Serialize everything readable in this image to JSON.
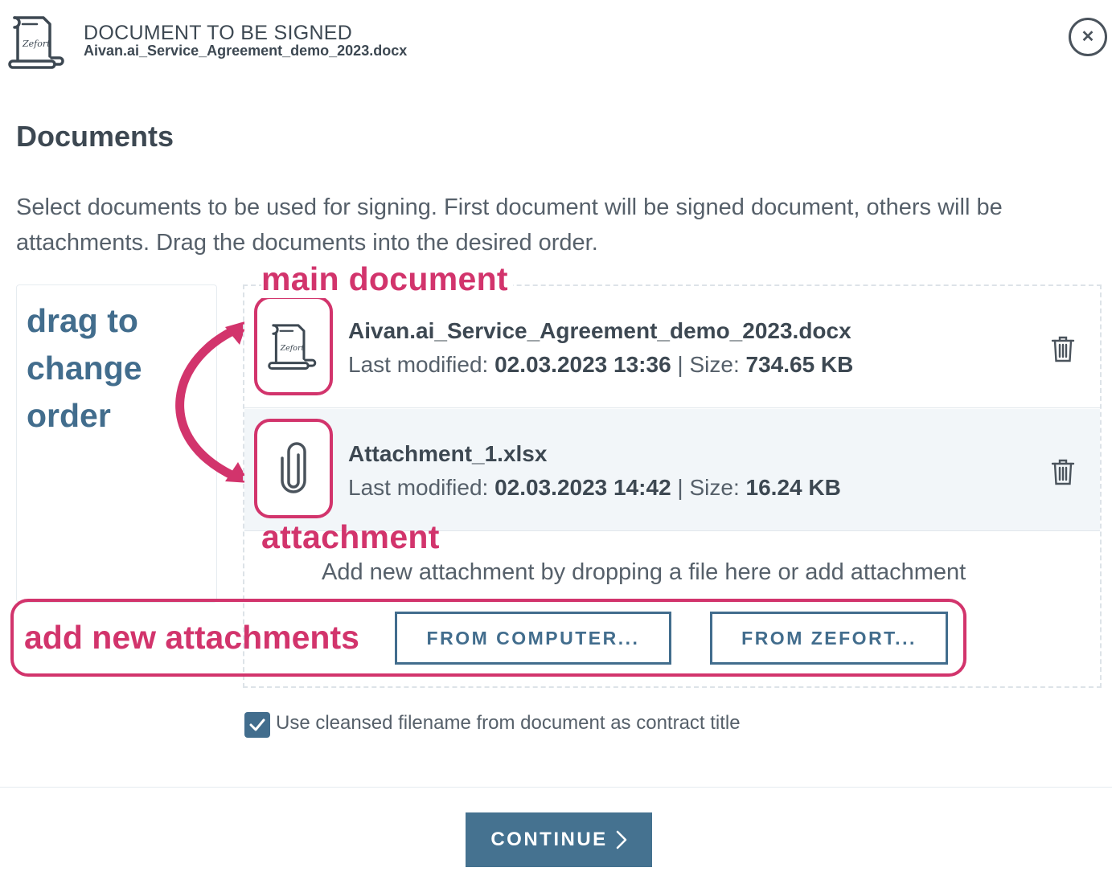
{
  "header": {
    "title": "DOCUMENT TO BE SIGNED",
    "filename": "Aivan.ai_Service_Agreement_demo_2023.docx"
  },
  "page_title": "Documents",
  "description": "Select documents to be used for signing. First document will be signed document, others will be attachments. Drag the documents into the desired order.",
  "documents": [
    {
      "name": "Aivan.ai_Service_Agreement_demo_2023.docx",
      "modified_label": "Last modified: ",
      "modified": "02.03.2023 13:36",
      "separator": " | ",
      "size_label": "Size: ",
      "size": "734.65 KB",
      "icon": "zefort-document-icon"
    },
    {
      "name": "Attachment_1.xlsx",
      "modified_label": "Last modified: ",
      "modified": "02.03.2023 14:42",
      "separator": " | ",
      "size_label": "Size: ",
      "size": "16.24 KB",
      "icon": "paperclip-icon"
    }
  ],
  "drop_hint": "Add new attachment by dropping a file here or add attachment",
  "buttons": {
    "from_computer": "FROM COMPUTER...",
    "from_zefort": "FROM ZEFORT...",
    "continue": "CONTINUE"
  },
  "checkbox": {
    "label": "Use cleansed filename from document as contract title",
    "checked": true
  },
  "annotations": {
    "drag": "drag to change order",
    "main": "main document",
    "attachment": "attachment",
    "add_new": "add new attachments"
  },
  "colors": {
    "accent": "#426d8d",
    "annotation": "#d2346c",
    "text": "#3d4852"
  }
}
